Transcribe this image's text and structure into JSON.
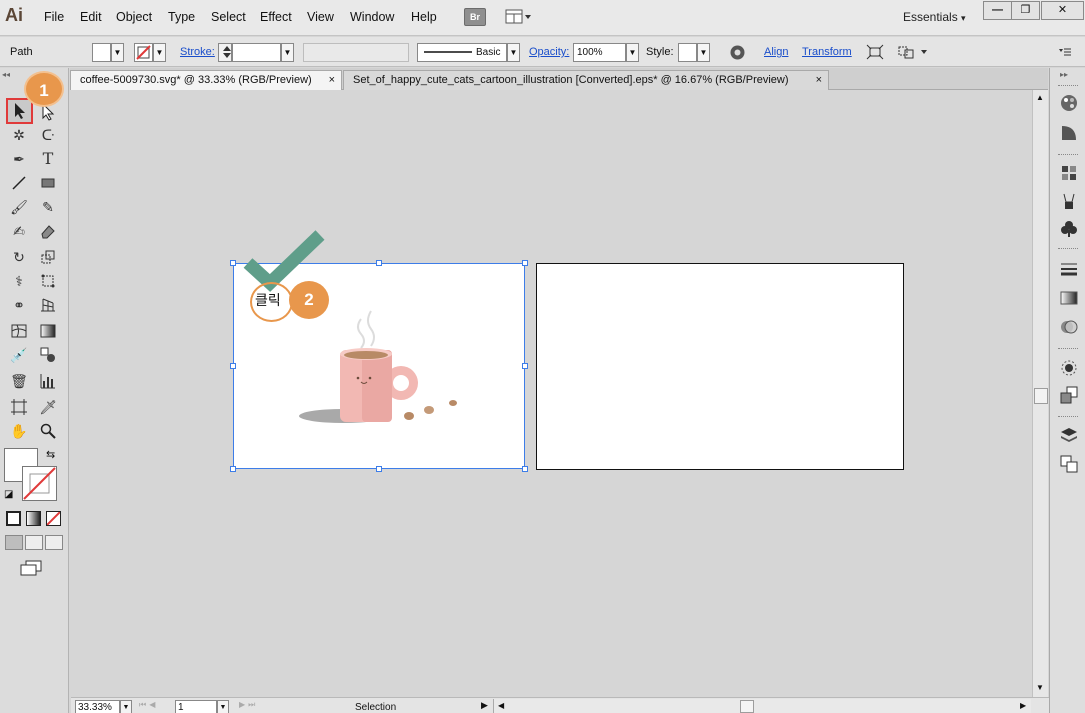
{
  "app": {
    "logo": "Ai",
    "bridge_label": "Br",
    "workspace": "Essentials"
  },
  "menu": [
    "File",
    "Edit",
    "Object",
    "Type",
    "Select",
    "Effect",
    "View",
    "Window",
    "Help"
  ],
  "window_controls": {
    "minimize": "—",
    "restore": "❐",
    "close": "✕"
  },
  "control_bar": {
    "selection_type": "Path",
    "stroke_label": "Stroke:",
    "brush_label": "Basic",
    "opacity_label": "Opacity:",
    "opacity_value": "100%",
    "style_label": "Style:",
    "align_label": "Align",
    "transform_label": "Transform"
  },
  "tabs": [
    {
      "label": "coffee-5009730.svg* @ 33.33% (RGB/Preview)",
      "close": "×",
      "active": true
    },
    {
      "label": "Set_of_happy_cute_cats_cartoon_illustration [Converted].eps* @ 16.67% (RGB/Preview)",
      "close": "×",
      "active": false
    }
  ],
  "status_bar": {
    "zoom": "33.33%",
    "artboard": "1",
    "tool_status": "Selection"
  },
  "callouts": {
    "step1": "1",
    "step2": "2",
    "click_text": "클릭"
  },
  "colors": {
    "accent_orange": "#e8974c",
    "check_green": "#5f9e8a",
    "selection_blue": "#3d7de8",
    "mug_pink": "#f2b8b3",
    "coffee": "#b88a66",
    "highlight_red": "#e03a3a"
  }
}
